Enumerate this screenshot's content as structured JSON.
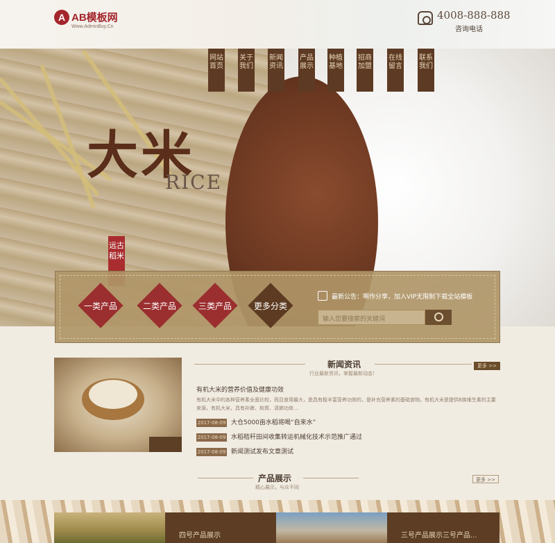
{
  "header": {
    "logo_mark": "A",
    "logo_name": "AB模板网",
    "logo_sub": "Www.AdminBuy.Cn",
    "phone_number": "4008-888-888",
    "phone_label": "咨询电话"
  },
  "nav": {
    "items": [
      {
        "label": "网站首页"
      },
      {
        "label": "关于我们"
      },
      {
        "label": "新闻资讯"
      },
      {
        "label": "产品展示"
      },
      {
        "label": "种植基地"
      },
      {
        "label": "招商加盟"
      },
      {
        "label": "在线留言"
      },
      {
        "label": "联系我们"
      }
    ]
  },
  "banner": {
    "big_text": "大米",
    "rice_word": "RICE",
    "seal_text": "远古稻米"
  },
  "categories": {
    "items": [
      {
        "label": "一类产品"
      },
      {
        "label": "二类产品"
      },
      {
        "label": "三类产品"
      },
      {
        "label": "更多分类"
      }
    ]
  },
  "notice": {
    "text": "最新公告：啊作分享，加入VIP无限制下载全站模板",
    "search_placeholder": "输入您要搜索的关键词"
  },
  "news": {
    "title": "新闻资讯",
    "subtitle": "行业最新资讯，掌握最新动态！",
    "more_label": "更多 >>",
    "headline": "有机大米的营养价值及健康功效",
    "summary": "有机大米中的各种营养素全面比较，而且食用最大，是具有极丰富营养功效的，是补充营养素的基础食物。有机大米是提供B族维生素的主要来源，有机大米，具有补脾、和胃、清肺功效...",
    "rows": [
      {
        "date": "2017-08-09",
        "title": "大仓5000亩水稻将喝“自来水”"
      },
      {
        "date": "2017-08-09",
        "title": "水稻秸秆田间收集转运机械化技术示范推广通过"
      },
      {
        "date": "2017-08-09",
        "title": "新闻测试发布文章测试"
      }
    ]
  },
  "products": {
    "title": "产品展示",
    "subtitle": "精心展示，与众不同",
    "more_label": "更多 >>",
    "items": [
      {
        "caption": "四号产品展示"
      },
      {
        "caption": "三号产品展示三号产品..."
      }
    ]
  }
}
